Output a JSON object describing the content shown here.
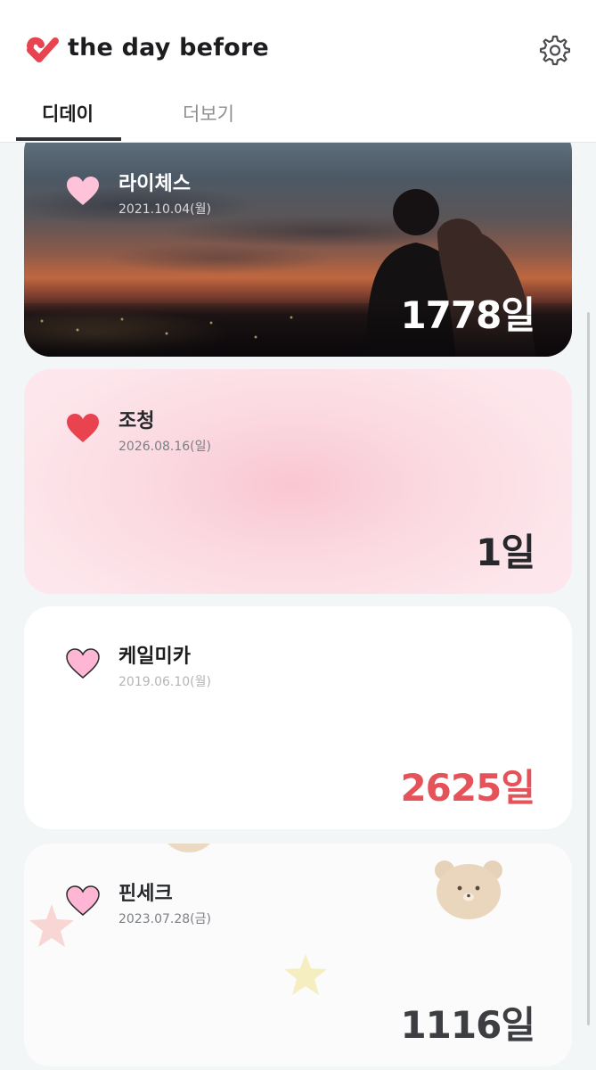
{
  "header": {
    "app_title": "the day before",
    "brand_color": "#e8434f",
    "tabs": [
      {
        "label": "디데이",
        "active": true
      },
      {
        "label": "더보기",
        "active": false
      }
    ]
  },
  "icons": {
    "logo": "check-heart-icon",
    "settings": "gear-icon"
  },
  "ddays": [
    {
      "name": "라이체스",
      "date": "2021.10.04(월)",
      "count": "1778일",
      "background": "sunset-couple-photo",
      "heart_color": "#ffc3d9"
    },
    {
      "name": "조청",
      "date": "2026.08.16(일)",
      "count": "1일",
      "background": "pink-gradient",
      "heart_color": "#e8434f"
    },
    {
      "name": "케일미카",
      "date": "2019.06.10(월)",
      "count": "2625일",
      "background": "white",
      "heart_color": "#ffb6d4",
      "count_color": "#e6525a"
    },
    {
      "name": "핀세크",
      "date": "2023.07.28(금)",
      "count": "1116일",
      "background": "bear-star-stickers",
      "heart_color": "#ffb6d4"
    }
  ]
}
